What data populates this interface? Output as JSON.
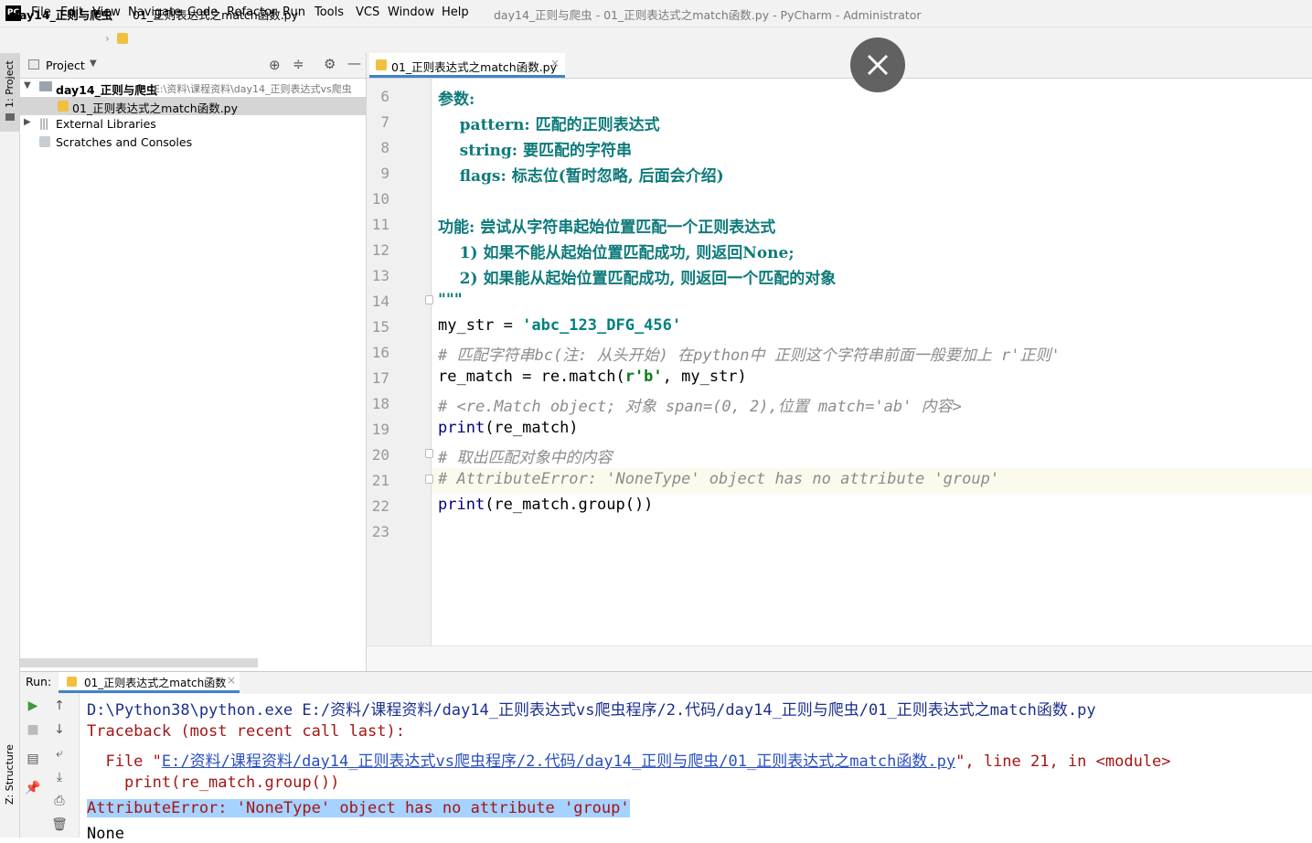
{
  "app": {
    "logo_text": "PC",
    "menu": [
      "File",
      "Edit",
      "View",
      "Navigate",
      "Code",
      "Refactor",
      "Run",
      "Tools",
      "VCS",
      "Window",
      "Help"
    ],
    "window_title": "day14_正则与爬虫 - 01_正则表达式之match函数.py - PyCharm - Administrator"
  },
  "breadcrumb": {
    "project": "day14_正则与爬虫",
    "file": "01_正则表达式之match函数.py"
  },
  "left_stripe": {
    "project_label": "1: Project",
    "structure_label": "Z: Structure"
  },
  "project_panel": {
    "title": "Project",
    "tree": [
      {
        "label": "day14_正则与爬虫",
        "hint": "E:\\资料\\课程资料\\day14_正则表达式vs爬虫"
      },
      {
        "label": "01_正则表达式之match函数.py",
        "hint": ""
      },
      {
        "label": "External Libraries",
        "hint": ""
      },
      {
        "label": "Scratches and Consoles",
        "hint": ""
      }
    ]
  },
  "editor": {
    "tab_label": "01_正则表达式之match函数.py",
    "line_numbers": [
      "6",
      "7",
      "8",
      "9",
      "10",
      "11",
      "12",
      "13",
      "14",
      "15",
      "16",
      "17",
      "18",
      "19",
      "20",
      "21",
      "22",
      "23"
    ],
    "lines": {
      "l6": "参数:",
      "l7": "    pattern: 匹配的正则表达式",
      "l8": "    string: 要匹配的字符串",
      "l9": "    flags: 标志位(暂时忽略, 后面会介绍)",
      "l11": "功能: 尝试从字符串起始位置匹配一个正则表达式",
      "l12": "    1) 如果不能从起始位置匹配成功, 则返回None;",
      "l13": "    2) 如果能从起始位置匹配成功, 则返回一个匹配的对象",
      "l14": "\"\"\"",
      "l15_a": "my_str = ",
      "l15_b": "'abc_123_DFG_456'",
      "l16": "# 匹配字符串bc(注: 从头开始) 在python中 正则这个字符串前面一般要加上 r'正则'",
      "l17_a": "re_match = re.match(",
      "l17_b": "r'b'",
      "l17_c": ", my_str)",
      "l18": "# <re.Match object; 对象 span=(0, 2),位置 match='ab' 内容>",
      "l19_a": "print",
      "l19_b": "(re_match)",
      "l20": "# 取出匹配对象中的内容",
      "l21": "# AttributeError: 'NoneType' object has no attribute 'group'",
      "l22_a": "print",
      "l22_b": "(re_match.group())"
    }
  },
  "run": {
    "label": "Run:",
    "tab_label": "01_正则表达式之match函数",
    "output": {
      "cmd": "D:\\Python38\\python.exe E:/资料/课程资料/day14_正则表达式vs爬虫程序/2.代码/day14_正则与爬虫/01_正则表达式之match函数.py",
      "traceback": "Traceback (most recent call last):",
      "file_prefix": "  File \"",
      "file_link": "E:/资料/课程资料/day14_正则表达式vs爬虫程序/2.代码/day14_正则与爬虫/01_正则表达式之match函数.py",
      "file_suffix": "\", line 21, in <module>",
      "code_line": "    print(re_match.group())",
      "error": "AttributeError: 'NoneType' object has no attribute 'group'",
      "none_line": "None"
    }
  },
  "colors": {
    "docstring": "#0e7a7a",
    "string": "#067d17",
    "comment": "#8c8c8c",
    "error_text": "#a31515",
    "link": "#2a4fbf",
    "selection": "#a6d2ff",
    "tab_underline": "#4083c9"
  }
}
